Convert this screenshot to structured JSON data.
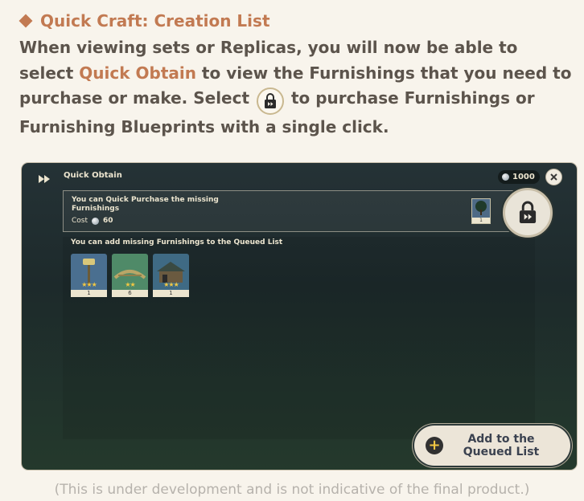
{
  "heading": "Quick Craft: Creation List",
  "paragraph": {
    "part1": "When viewing sets or Replicas, you will now be able to select ",
    "highlight": "Quick Obtain",
    "part2": " to view the Furnishings that you need to purchase or make. Select ",
    "part3": " to purchase Furnishings or Furnishing Blueprints with a single click."
  },
  "screen": {
    "title": "Quick Obtain",
    "currency_amount": "1000",
    "purchase_panel": {
      "message": "You can Quick Purchase the missing Furnishings",
      "cost_label": "Cost",
      "cost_value": "60",
      "thumb_count": "1"
    },
    "queue_text": "You can add missing Furnishings to the Queued List",
    "items": [
      {
        "name": "lamp-post",
        "stars": "★★★",
        "count": "1"
      },
      {
        "name": "arch-bridge",
        "stars": "★★",
        "count": "6"
      },
      {
        "name": "pavilion",
        "stars": "★★★",
        "count": "1"
      }
    ],
    "add_button_label": "Add to the\nQueued List"
  },
  "colors": {
    "accent": "#c27a52",
    "body_text": "#5c544c",
    "panel_bg": "#1d2a2b"
  },
  "disclaimer": "(This is under development and is not indicative of the final product.)"
}
